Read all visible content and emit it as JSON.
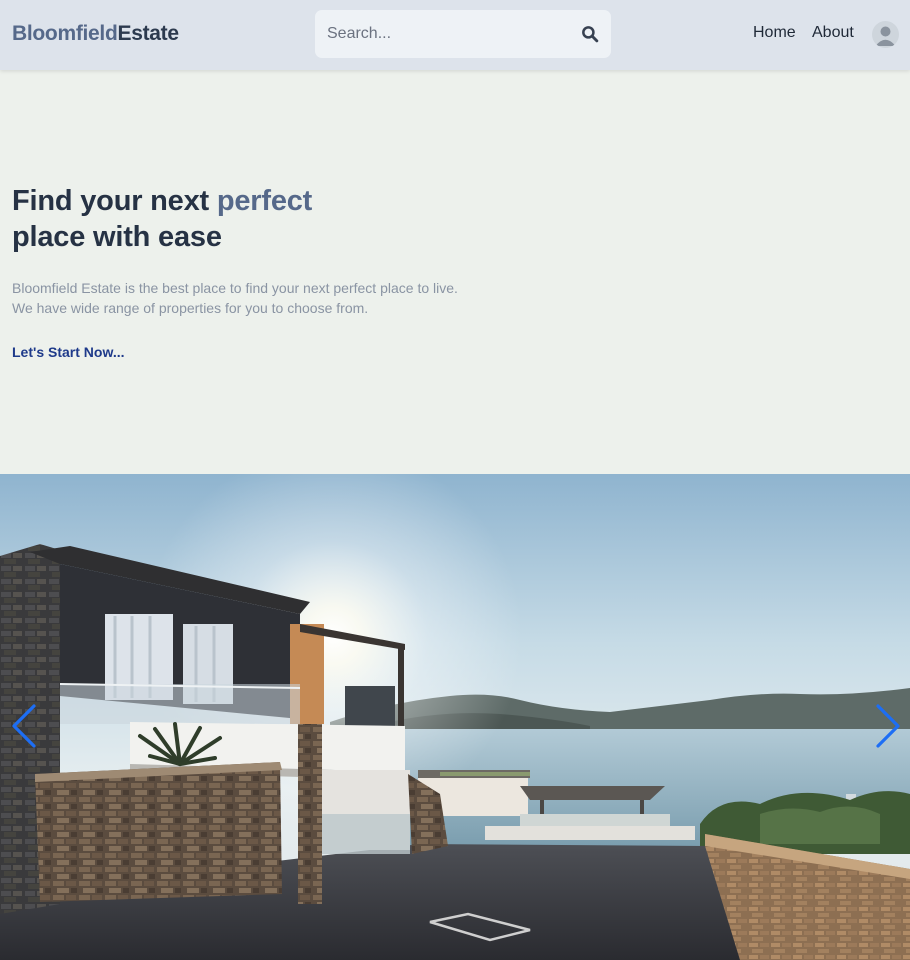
{
  "navbar": {
    "brand_part1": "Bloomfield",
    "brand_part2": "Estate",
    "search_placeholder": "Search...",
    "search_icon": "search-icon",
    "links": [
      {
        "label": "Home"
      },
      {
        "label": "About"
      }
    ],
    "avatar_icon": "user-avatar-icon"
  },
  "hero": {
    "title_before": "Find your next ",
    "title_accent": "perfect",
    "title_after": "place with ease",
    "description_line1": "Bloomfield Estate is the best place to find your next perfect place to live.",
    "description_line2": "We have wide range of properties for you to choose from.",
    "cta_label": "Let's Start Now..."
  },
  "carousel": {
    "prev_icon": "chevron-left-icon",
    "next_icon": "chevron-right-icon",
    "image_subject": "seaside villa at sunset"
  },
  "colors": {
    "background": "#edf1ec",
    "navbar": "#dde3eb",
    "accent": "#56698a",
    "heading": "#263244",
    "cta": "#1e3a8a",
    "carousel_arrow": "#1d6ef5"
  }
}
